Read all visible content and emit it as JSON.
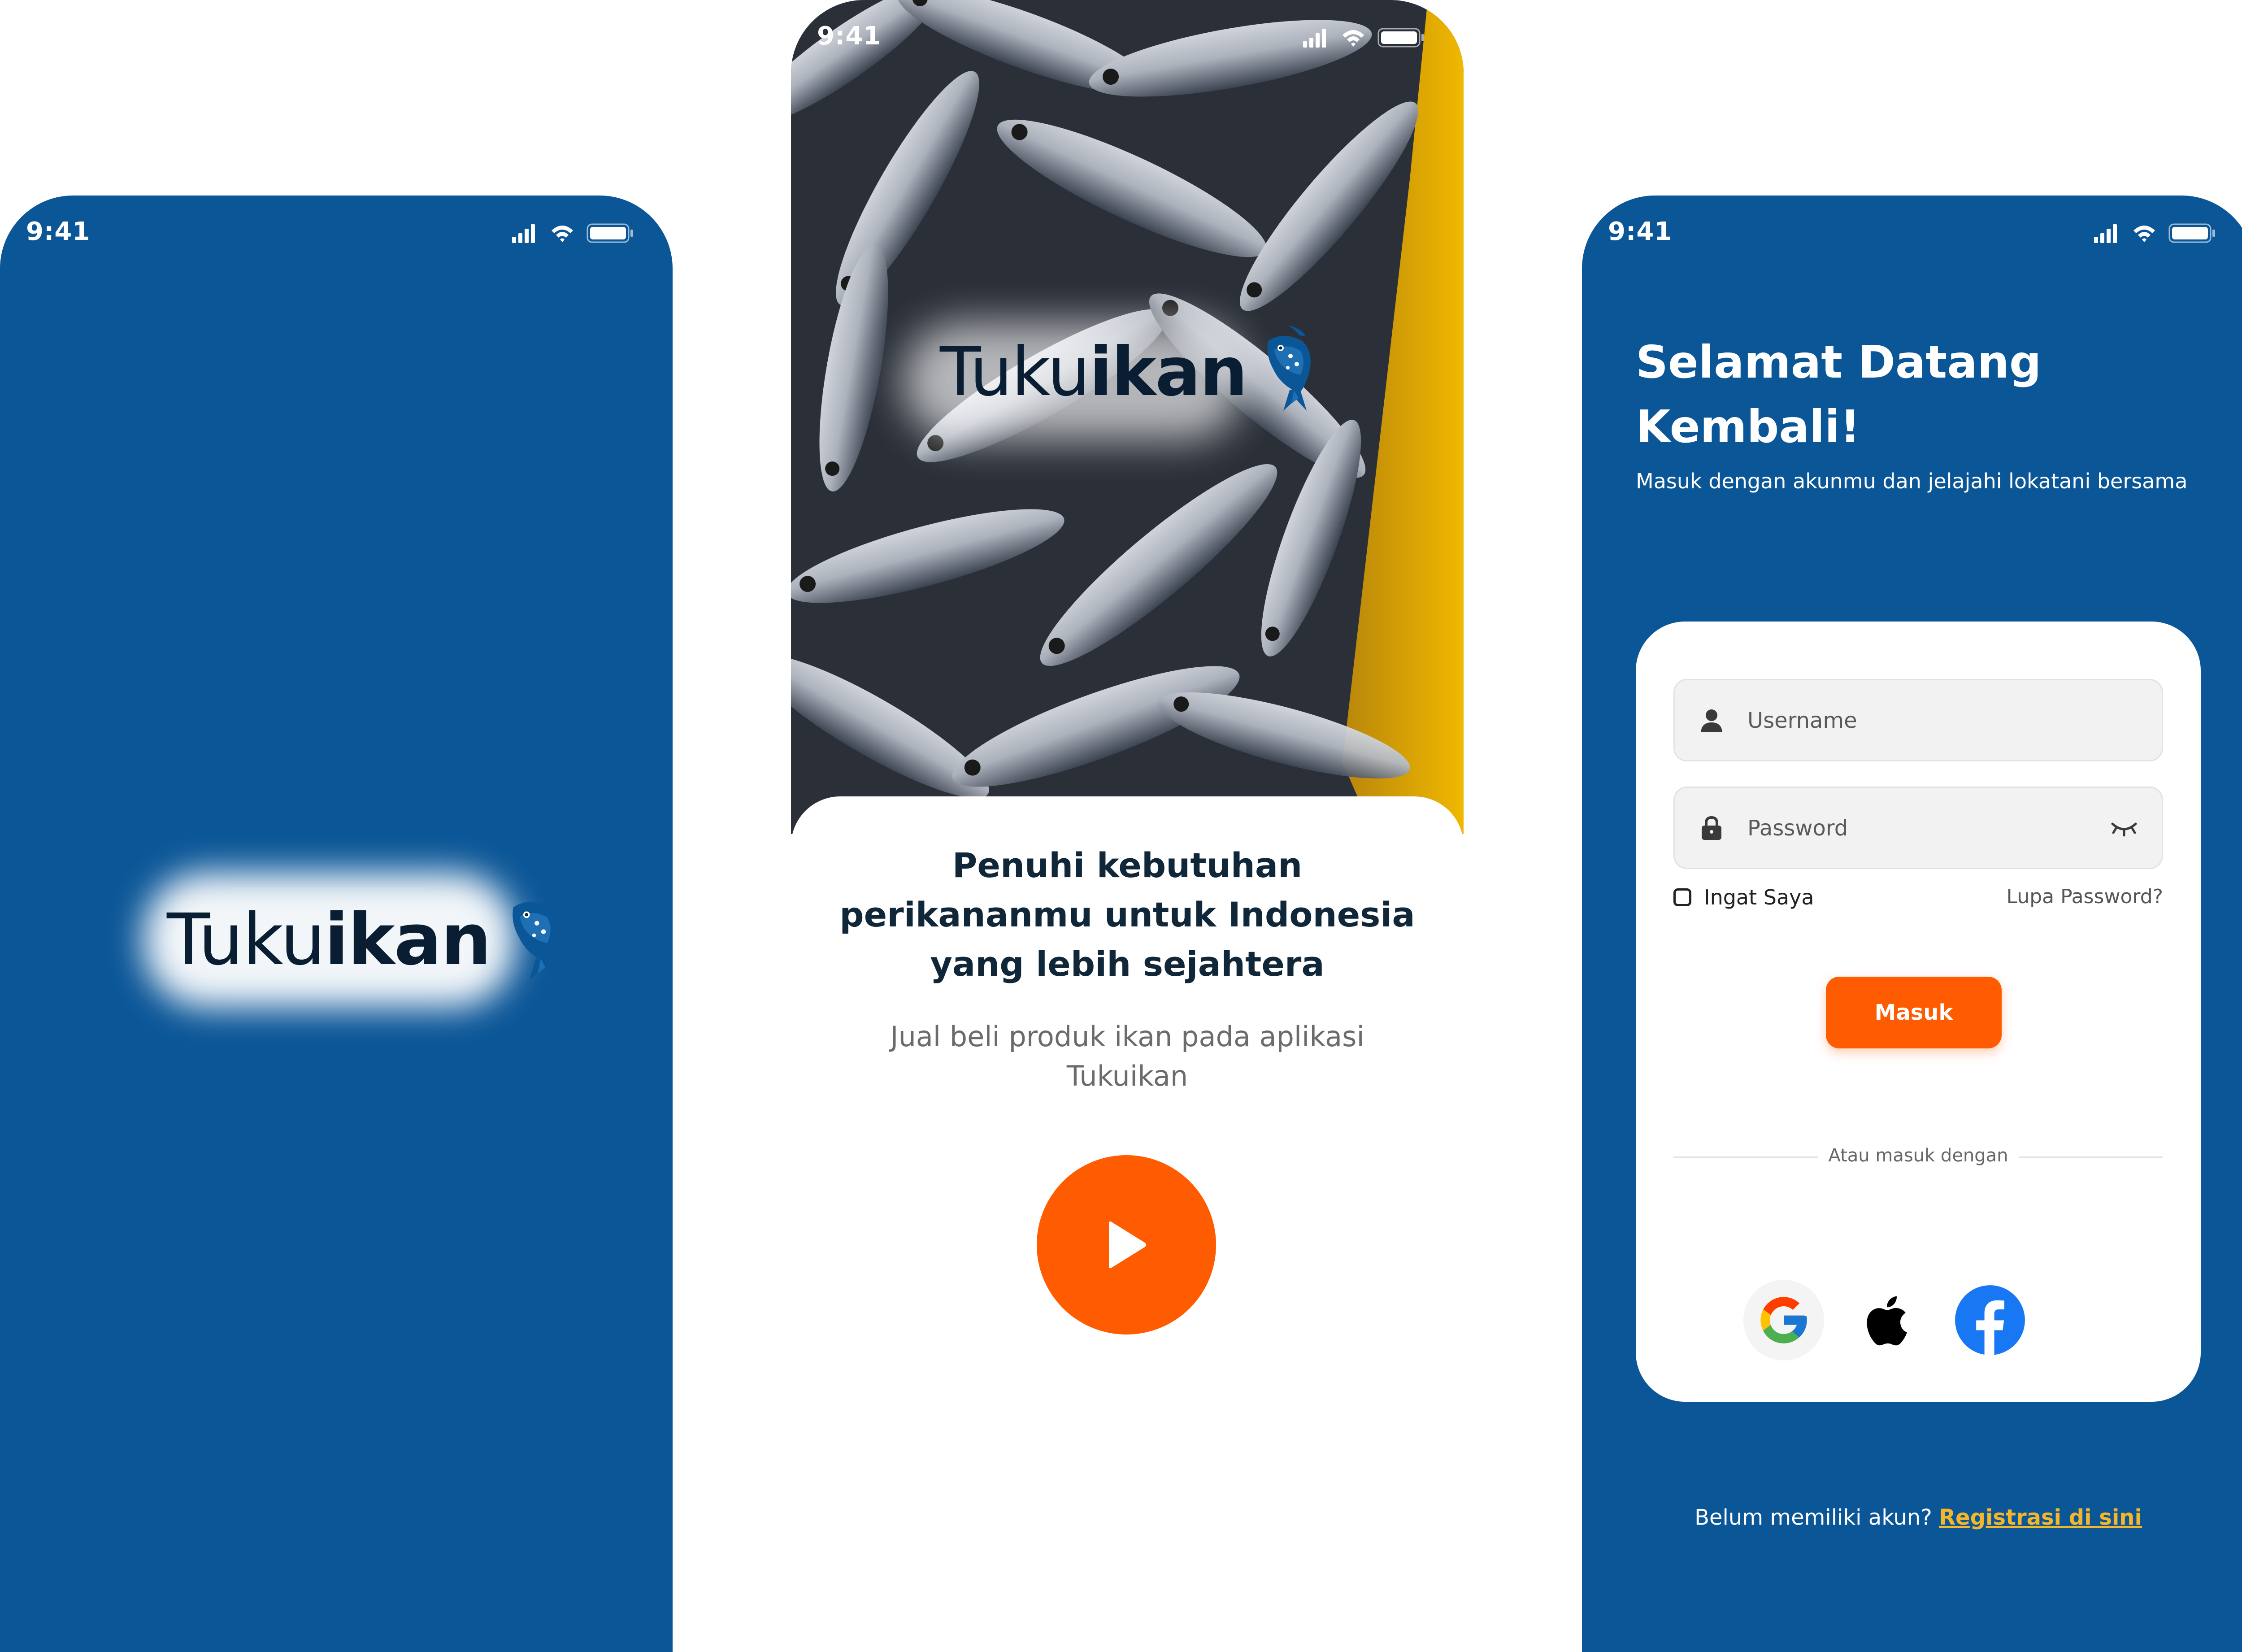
{
  "status_bar": {
    "time": "9:41"
  },
  "brand": {
    "name_light": "Tuku",
    "name_bold": "ikan"
  },
  "onboarding": {
    "title": "Penuhi kebutuhan perikananmu untuk Indonesia yang lebih sejahtera",
    "subtitle": "Jual beli produk ikan pada aplikasi Tukuikan",
    "next_button_icon": "play-icon"
  },
  "login": {
    "heading": "Selamat Datang\nKembali!",
    "subheading": "Masuk dengan akunmu dan jelajahi lokatani bersama",
    "username": {
      "placeholder": "Username",
      "value": "",
      "icon": "user-icon"
    },
    "password": {
      "placeholder": "Password",
      "value": "",
      "icon": "lock-icon",
      "toggle_icon": "eye-closed-icon"
    },
    "remember_label": "Ingat Saya",
    "remember_checked": false,
    "forgot_label": "Lupa Password?",
    "submit_label": "Masuk",
    "divider_label": "Atau masuk dengan",
    "social": [
      "google-icon",
      "apple-icon",
      "facebook-icon"
    ],
    "register_prompt": "Belum memiliki akun?",
    "register_link": "Registrasi di sini"
  },
  "colors": {
    "primary_blue": "#0b5697",
    "accent_orange": "#ff5b00",
    "link_yellow": "#f5b62a",
    "logo_navy": "#0a1e33"
  }
}
